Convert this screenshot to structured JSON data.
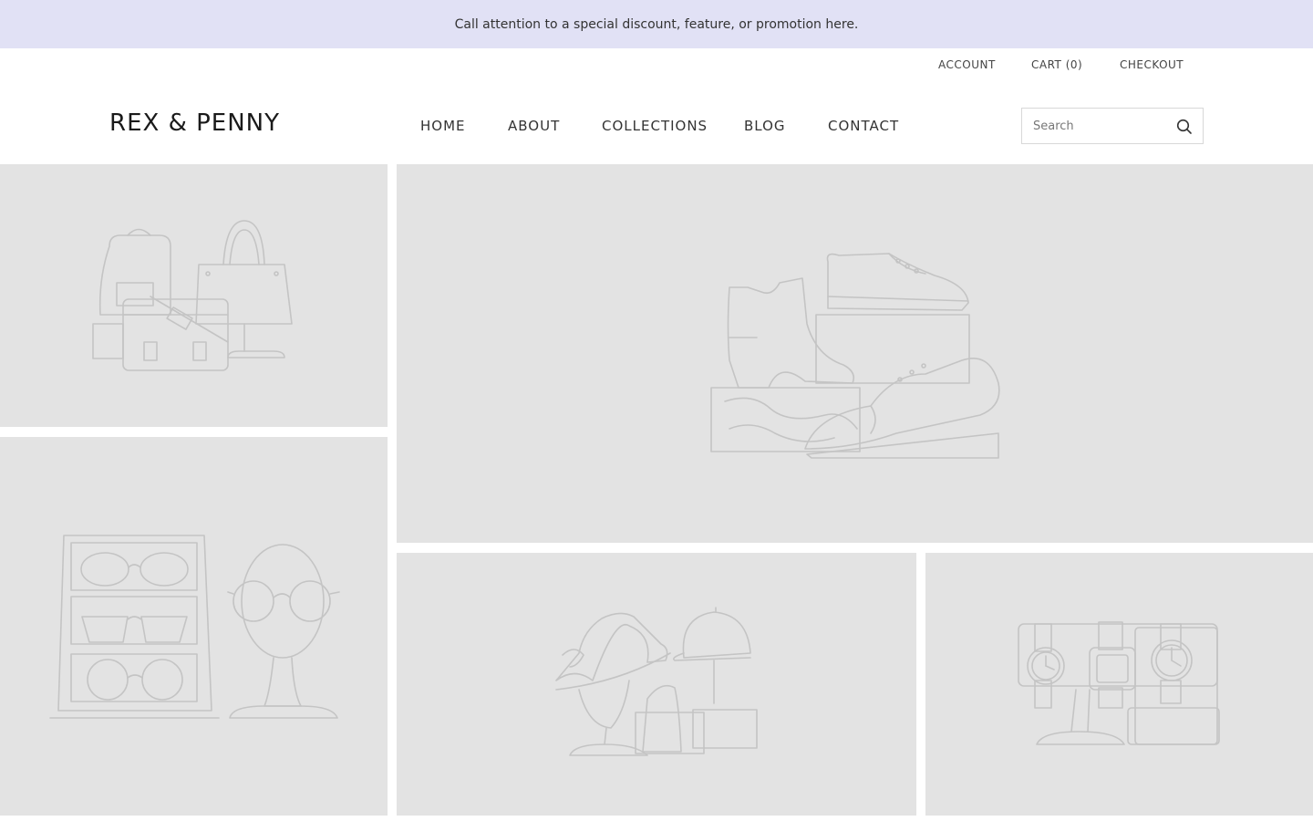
{
  "announcement": {
    "text": "Call attention to a special discount, feature, or promotion here."
  },
  "utility_nav": {
    "account": "ACCOUNT",
    "cart": "CART (0)",
    "checkout": "CHECKOUT"
  },
  "header": {
    "logo": "REX & PENNY",
    "nav": [
      "HOME",
      "ABOUT",
      "COLLECTIONS",
      "BLOG",
      "CONTACT"
    ],
    "search": {
      "placeholder": "Search"
    }
  },
  "tiles": [
    {
      "icon": "bags-illustration"
    },
    {
      "icon": "shoes-illustration"
    },
    {
      "icon": "glasses-illustration"
    },
    {
      "icon": "hats-illustration"
    },
    {
      "icon": "watches-illustration"
    }
  ],
  "colors": {
    "announcement_bg": "#e1e1f5",
    "tile_bg": "#e3e3e3",
    "illustration_stroke": "#c4c4c4"
  }
}
